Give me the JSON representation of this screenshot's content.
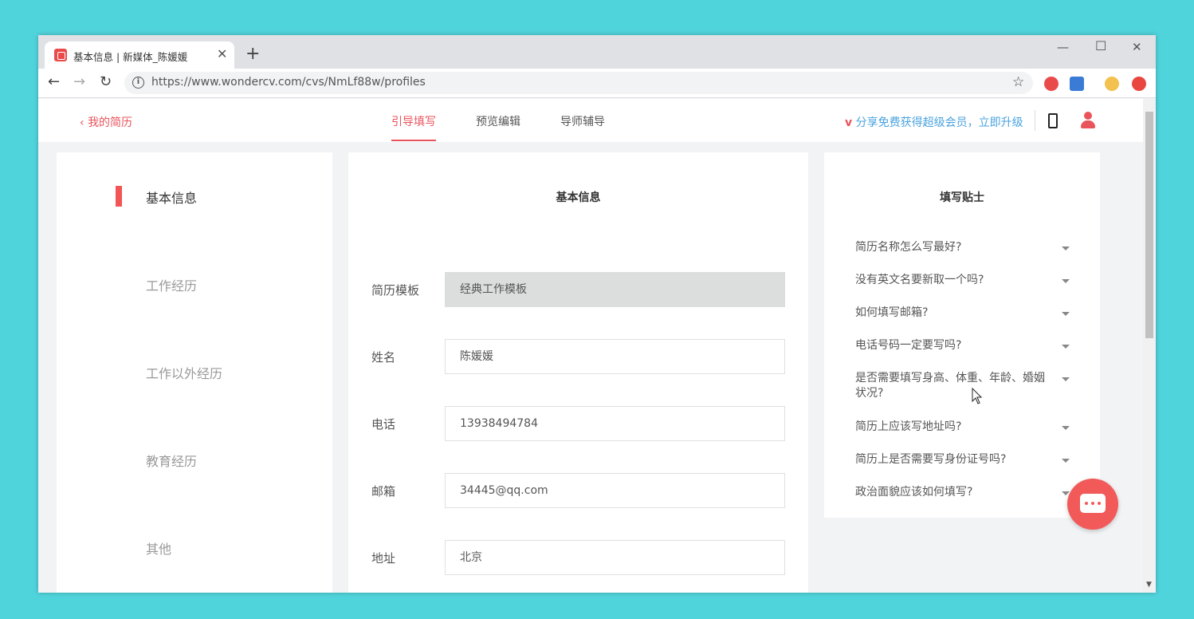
{
  "browser": {
    "tab_title": "基本信息 | 新媒体_陈媛媛",
    "new_tab": "+",
    "url": "https://www.wondercv.com/cvs/NmLf88w/profiles"
  },
  "header": {
    "back_label": "我的简历",
    "tabs": [
      {
        "label": "引导填写"
      },
      {
        "label": "预览编辑"
      },
      {
        "label": "导师辅导"
      }
    ],
    "share_prefix": "v",
    "share_text": "分享免费获得超级会员，立即升级"
  },
  "sidebar": {
    "items": [
      {
        "label": "基本信息"
      },
      {
        "label": "工作经历"
      },
      {
        "label": "工作以外经历"
      },
      {
        "label": "教育经历"
      },
      {
        "label": "其他"
      }
    ]
  },
  "form": {
    "title": "基本信息",
    "fields": [
      {
        "label": "简历模板",
        "value": "经典工作模板"
      },
      {
        "label": "姓名",
        "value": "陈媛媛"
      },
      {
        "label": "电话",
        "value": "13938494784"
      },
      {
        "label": "邮箱",
        "value": "34445@qq.com"
      },
      {
        "label": "地址",
        "value": "北京"
      }
    ]
  },
  "tips": {
    "title": "填写贴士",
    "items": [
      {
        "q": "简历名称怎么写最好?"
      },
      {
        "q": "没有英文名要新取一个吗?"
      },
      {
        "q": "如何填写邮箱?"
      },
      {
        "q": "电话号码一定要写吗?"
      },
      {
        "q": "是否需要填写身高、体重、年龄、婚姻状况?"
      },
      {
        "q": "简历上应该写地址吗?"
      },
      {
        "q": "简历上是否需要写身份证号吗?"
      },
      {
        "q": "政治面貌应该如何填写?"
      }
    ]
  },
  "colors": {
    "accent": "#e9545b",
    "link": "#4aa3df",
    "backdrop": "#50d4dc"
  }
}
